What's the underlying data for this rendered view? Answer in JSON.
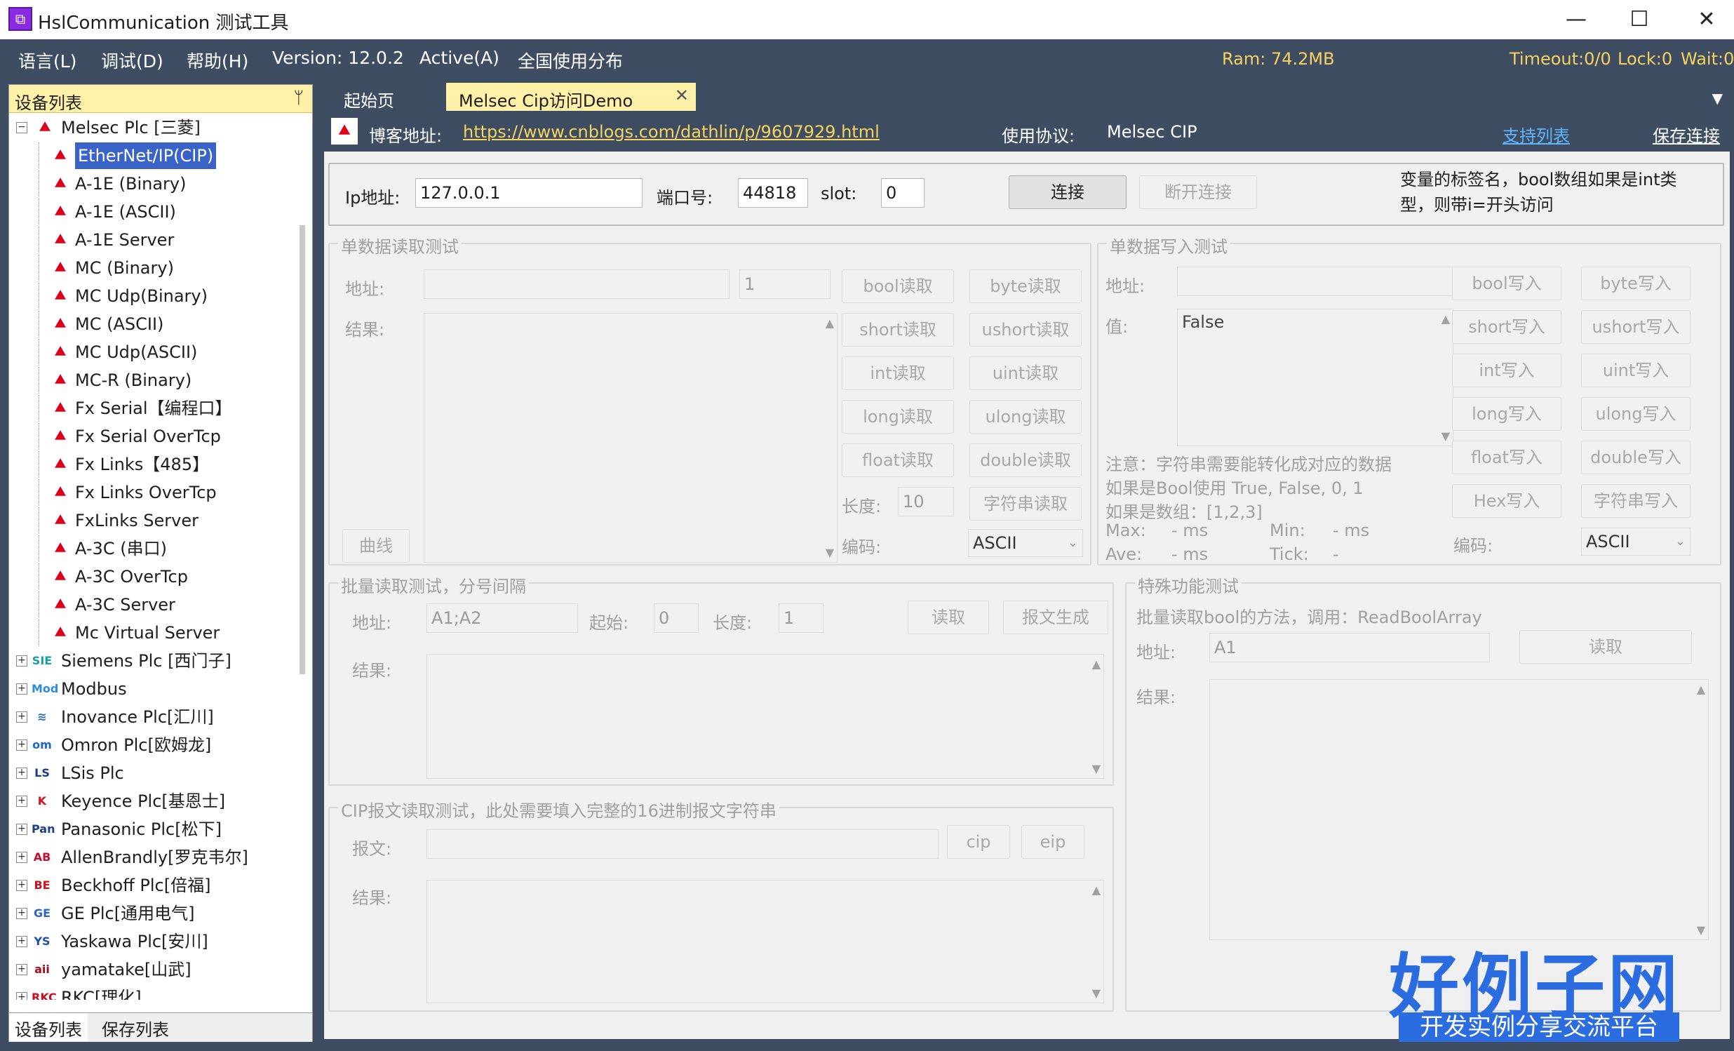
{
  "window": {
    "title": "HslCommunication 测试工具",
    "minimize": "—",
    "maximize": "☐",
    "close": "✕"
  },
  "menu": {
    "items": [
      "语言(L)",
      "调试(D)",
      "帮助(H)",
      "Version: 12.0.2",
      "Active(A)",
      "全国使用分布"
    ],
    "ram": "Ram: 74.2MB",
    "timeout": "Timeout:0/0",
    "lock": "Lock:0",
    "wait": "Wait:0"
  },
  "dock": {
    "title": "设备列表",
    "pin": "ᛘ",
    "tabs": [
      "设备列表",
      "保存列表"
    ]
  },
  "tree": {
    "root": {
      "label": "Melsec Plc [三菱]",
      "expander": "−"
    },
    "children": [
      "EtherNet/IP(CIP)",
      "A-1E (Binary)",
      "A-1E (ASCII)",
      "A-1E Server",
      "MC (Binary)",
      "MC Udp(Binary)",
      "MC (ASCII)",
      "MC Udp(ASCII)",
      "MC-R (Binary)",
      "Fx Serial【编程口】",
      "Fx Serial OverTcp",
      "Fx Links【485】",
      "Fx Links OverTcp",
      "FxLinks Server",
      "A-3C (串口)",
      "A-3C OverTcp",
      "A-3C Server",
      "Mc Virtual Server"
    ],
    "groups": [
      {
        "label": "Siemens Plc [西门子]",
        "icon": "SIE",
        "color": "#199fa4"
      },
      {
        "label": "Modbus",
        "icon": "Mod",
        "color": "#2d8be0"
      },
      {
        "label": "Inovance Plc[汇川]",
        "icon": "≋",
        "color": "#2d6ab8"
      },
      {
        "label": "Omron Plc[欧姆龙]",
        "icon": "om",
        "color": "#1d66c8"
      },
      {
        "label": "LSis Plc",
        "icon": "LS",
        "color": "#1d3a8a"
      },
      {
        "label": "Keyence Plc[基恩士]",
        "icon": "K",
        "color": "#d0101a"
      },
      {
        "label": "Panasonic Plc[松下]",
        "icon": "Pan",
        "color": "#1b3e8e"
      },
      {
        "label": "AllenBrandly[罗克韦尔]",
        "icon": "AB",
        "color": "#c8102e"
      },
      {
        "label": "Beckhoff Plc[倍福]",
        "icon": "BE",
        "color": "#d0101a"
      },
      {
        "label": "GE Plc[通用电气]",
        "icon": "GE",
        "color": "#2b66c4"
      },
      {
        "label": "Yaskawa Plc[安川]",
        "icon": "YS",
        "color": "#1e4fa8"
      },
      {
        "label": "yamatake[山武]",
        "icon": "aii",
        "color": "#a0101a"
      },
      {
        "label": "RKC[理化]",
        "icon": "RKC",
        "color": "#c81020"
      }
    ],
    "expander_collapsed": "+"
  },
  "tabs": {
    "start": "起始页",
    "active": "Melsec Cip访问Demo",
    "close": "✕",
    "menu": "▼"
  },
  "info": {
    "blog_label": "博客地址:",
    "blog_url": "https://www.cnblogs.com/dathlin/p/9607929.html",
    "protocol_label": "使用协议:",
    "protocol": "Melsec CIP",
    "support_list": "支持列表",
    "save_conn": "保存连接"
  },
  "conn": {
    "ip_label": "Ip地址:",
    "ip": "127.0.0.1",
    "port_label": "端口号:",
    "port": "44818",
    "slot_label": "slot:",
    "slot": "0",
    "connect": "连接",
    "disconnect": "断开连接",
    "hint": "变量的标签名，bool数组如果是int类型，则带i=开头访问"
  },
  "read": {
    "title": "单数据读取测试",
    "addr_label": "地址:",
    "addr": "",
    "count": "1",
    "result_label": "结果:",
    "curve": "曲线",
    "buttons": [
      "bool读取",
      "byte读取",
      "short读取",
      "ushort读取",
      "int读取",
      "uint读取",
      "long读取",
      "ulong读取",
      "float读取",
      "double读取"
    ],
    "len_label": "长度:",
    "len": "10",
    "string_read": "字符串读取",
    "enc_label": "编码:",
    "enc": "ASCII"
  },
  "write": {
    "title": "单数据写入测试",
    "addr_label": "地址:",
    "value_label": "值:",
    "value": "False",
    "buttons": [
      "bool写入",
      "byte写入",
      "short写入",
      "ushort写入",
      "int写入",
      "uint写入",
      "long写入",
      "ulong写入",
      "float写入",
      "double写入",
      "Hex写入",
      "字符串写入"
    ],
    "note1": "注意：字符串需要能转化成对应的数据",
    "note2": "如果是Bool使用 True, False, 0, 1",
    "note3": "如果是数组：[1,2,3]",
    "max_label": "Max:",
    "max": "- ms",
    "min_label": "Min:",
    "min": "- ms",
    "ave_label": "Ave:",
    "ave": "- ms",
    "tick_label": "Tick:",
    "tick": "-",
    "enc_label": "编码:",
    "enc": "ASCII"
  },
  "batch": {
    "title": "批量读取测试，分号间隔",
    "addr_label": "地址:",
    "addr": "A1;A2",
    "start_label": "起始:",
    "start": "0",
    "len_label": "长度:",
    "len": "1",
    "read": "读取",
    "gen": "报文生成",
    "result_label": "结果:"
  },
  "special": {
    "title": "特殊功能测试",
    "desc": "批量读取bool的方法，调用：ReadBoolArray",
    "addr_label": "地址:",
    "addr": "A1",
    "read": "读取",
    "result_label": "结果:"
  },
  "cip": {
    "title": "CIP报文读取测试，此处需要填入完整的16进制报文字符串",
    "msg_label": "报文:",
    "cip": "cip",
    "eip": "eip",
    "result_label": "结果:"
  },
  "watermark": {
    "big": "好例子网",
    "small": "开发实例分享交流平台"
  },
  "colors": {
    "accent": "#3f4d63",
    "tab_active": "#fff2a8",
    "status": "#f5d35e",
    "selected": "#3a63c8",
    "mitsubishi": "#e0001a"
  }
}
